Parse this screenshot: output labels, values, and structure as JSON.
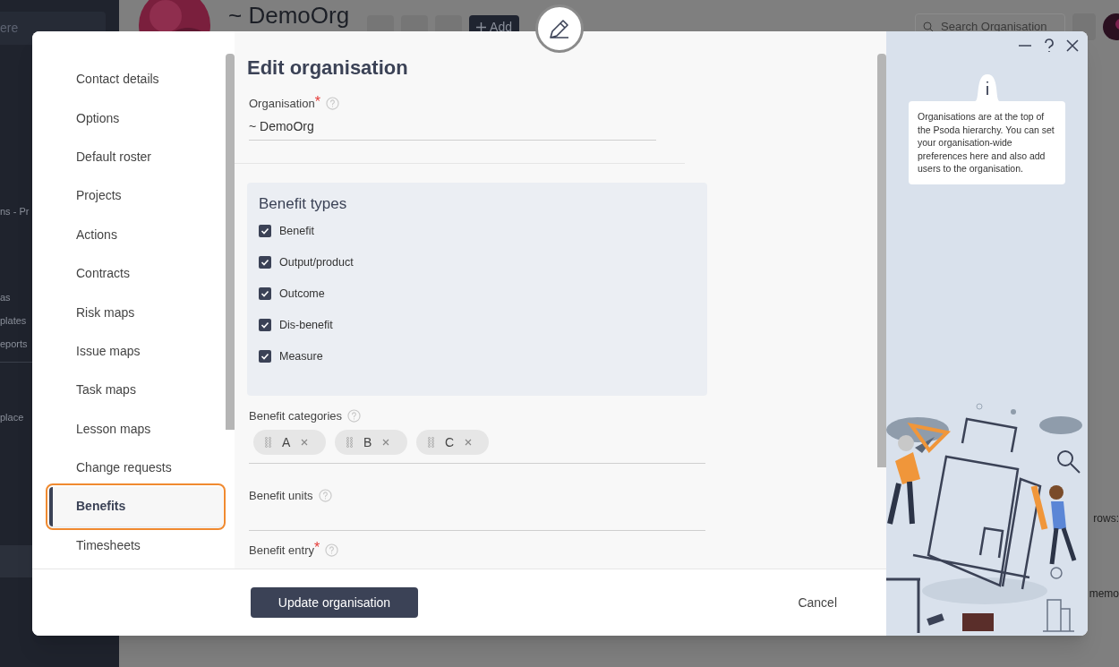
{
  "background": {
    "sidebar": {
      "search_placeholder": "ere",
      "items": [
        {
          "label": "ns - Pr"
        },
        {
          "label": "as"
        },
        {
          "label": "plates"
        },
        {
          "label": "eports"
        },
        {
          "label": "place"
        }
      ]
    },
    "header": {
      "title": "~ DemoOrg",
      "add_button": "Add",
      "search_placeholder": "Search Organisation"
    },
    "right_texts": [
      "rows:",
      "memo"
    ]
  },
  "modal": {
    "title": "Edit organisation",
    "nav": [
      {
        "label": "Contact details",
        "selected": false
      },
      {
        "label": "Options",
        "selected": false
      },
      {
        "label": "Default roster",
        "selected": false
      },
      {
        "label": "Projects",
        "selected": false
      },
      {
        "label": "Actions",
        "selected": false
      },
      {
        "label": "Contracts",
        "selected": false
      },
      {
        "label": "Risk maps",
        "selected": false
      },
      {
        "label": "Issue maps",
        "selected": false
      },
      {
        "label": "Task maps",
        "selected": false
      },
      {
        "label": "Lesson maps",
        "selected": false
      },
      {
        "label": "Change requests",
        "selected": false
      },
      {
        "label": "Benefits",
        "selected": true
      },
      {
        "label": "Timesheets",
        "selected": false
      }
    ],
    "organisation": {
      "label": "Organisation",
      "required_mark": "*",
      "value": "~ DemoOrg"
    },
    "benefit_types": {
      "title": "Benefit types",
      "items": [
        {
          "label": "Benefit",
          "checked": true
        },
        {
          "label": "Output/product",
          "checked": true
        },
        {
          "label": "Outcome",
          "checked": true
        },
        {
          "label": "Dis-benefit",
          "checked": true
        },
        {
          "label": "Measure",
          "checked": true
        }
      ]
    },
    "benefit_categories": {
      "label": "Benefit categories",
      "tags": [
        "A",
        "B",
        "C"
      ]
    },
    "benefit_units": {
      "label": "Benefit units"
    },
    "benefit_entry": {
      "label": "Benefit entry",
      "required_mark": "*"
    },
    "footer": {
      "submit": "Update organisation",
      "cancel": "Cancel"
    },
    "help": "Organisations are at the top of the Psoda hierarchy. You can set your organisation-wide preferences here and also add users to the organisation."
  }
}
